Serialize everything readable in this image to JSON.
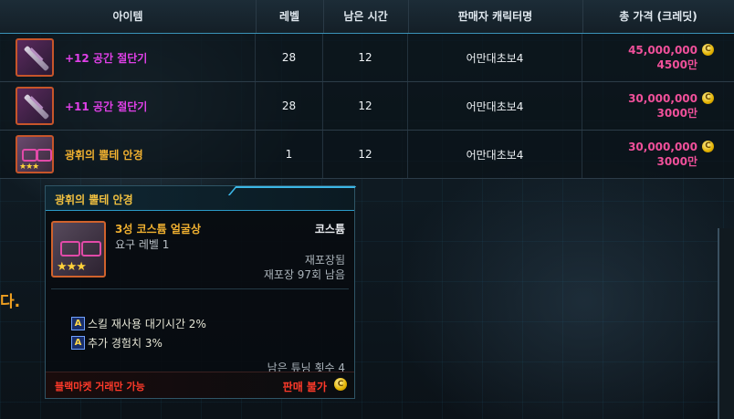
{
  "table": {
    "headers": {
      "item": "아이템",
      "level": "레벨",
      "time_left": "남은 시간",
      "seller": "판매자 캐릭터명",
      "total_price": "총 가격 (크레딧)"
    },
    "rows": [
      {
        "name": "+12 공간 절단기",
        "level": "28",
        "time_left": "12",
        "seller": "어만대초보4",
        "price": "45,000,000",
        "price_short": "4500만",
        "icon": "space-cutter-icon",
        "name_color": "#e040e8"
      },
      {
        "name": "+11 공간 절단기",
        "level": "28",
        "time_left": "12",
        "seller": "어만대초보4",
        "price": "30,000,000",
        "price_short": "3000만",
        "icon": "space-cutter-icon",
        "name_color": "#e040e8"
      },
      {
        "name": "광휘의 뿔테 안경",
        "level": "1",
        "time_left": "12",
        "seller": "어만대초보4",
        "price": "30,000,000",
        "price_short": "3000만",
        "icon": "horn-rimmed-glasses-icon",
        "name_color": "#f0b030"
      }
    ],
    "coin_symbol": "C"
  },
  "background_text": "다.",
  "tooltip": {
    "title": "광휘의 뿔테 안경",
    "grade": "3성 코스튬 얼굴상",
    "requirement": "요구 레벨 1",
    "type": "코스튬",
    "reseal": "재포장됨",
    "reseal_count": "재포장 97회 남음",
    "stars": "★★★",
    "options": [
      {
        "badge": "A",
        "text": "스킬 재사용 대기시간 2%"
      },
      {
        "badge": "A",
        "text": "추가 경험치 3%"
      }
    ],
    "tuning": "남은 튜닝 횟수 4",
    "black_market": "블랙마켓 거래만 가능",
    "not_for_sale": "판매 불가",
    "coin_symbol": "C"
  },
  "colors": {
    "price": "#f0509a",
    "accent": "#2b9ac8",
    "warning": "#ff3a2a"
  }
}
